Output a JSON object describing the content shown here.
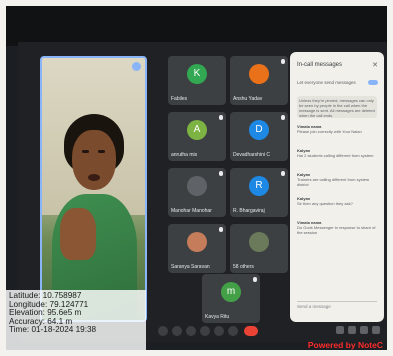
{
  "meeting": {
    "participants": [
      {
        "name": "Fabiles",
        "initial": "K",
        "color": "#33a852"
      },
      {
        "name": "Anshu Yadav",
        "initial": "",
        "color": "#e8711a"
      },
      {
        "name": "anrutha mis",
        "initial": "A",
        "color": "#7cb342"
      },
      {
        "name": "Devadharshini C",
        "initial": "D",
        "color": "#1e88e5"
      },
      {
        "name": "Manohar Manohar",
        "initial": "",
        "color": "#5f6368"
      },
      {
        "name": "R. Bhargaviraj",
        "initial": "R",
        "color": "#1e88e5"
      },
      {
        "name": "Saranya Saravan",
        "initial": "",
        "color": "#c47c5a"
      },
      {
        "name": "58 others",
        "initial": "",
        "color": "#6a7a5a"
      },
      {
        "name": "Kavya Ritu",
        "initial": "m",
        "color": "#43a047"
      }
    ]
  },
  "chat": {
    "title": "In-call messages",
    "close_icon": "close-icon",
    "toggle_label": "Let everyone send messages",
    "notice": "Unless they're pinned, messages can only be seen by people in the call when the message is sent. All messages are deleted when the call ends.",
    "messages": [
      {
        "who": "Vimala nama",
        "text": "Please join correctly with Your Nalan"
      },
      {
        "who": "Kalyan",
        "text": "Hai 2 students calling different from system"
      },
      {
        "who": "Kalyan",
        "text": "Trainers are calling different from system district"
      },
      {
        "who": "Kalyan",
        "text": "Sir then any question they ask?"
      },
      {
        "who": "Vimala nama",
        "text": "Do Gods Messenger in response to share of the session"
      }
    ],
    "input_placeholder": "Send a message"
  },
  "gps": {
    "latitude": "Latitude: 10.758987",
    "longitude": "Longitude: 79.124771",
    "elevation": "Elevation: 95.6e5 m",
    "accuracy": "Accuracy: 64.1 m",
    "time": "Time: 01-18-2024 19:38"
  },
  "watermark": "Powered by NoteC"
}
